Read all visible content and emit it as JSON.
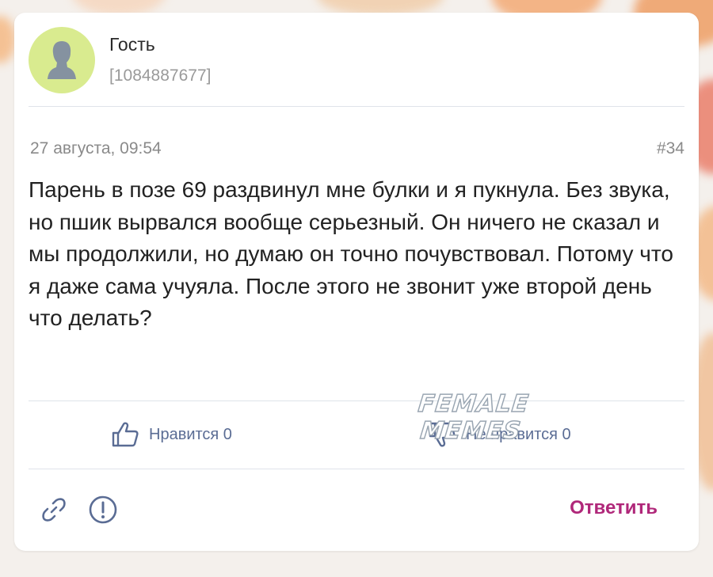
{
  "author": {
    "name": "Гость",
    "id": "[1084887677]"
  },
  "post": {
    "date": "27 августа, 09:54",
    "number": "#34",
    "text": "Парень в позе 69 раздвинул мне булки и я пукнула. Без звука, но пшик вырвался вообще серьезный. Он ничего не сказал и мы продолжили, но думаю он точно почувствовал. Потому что я даже сама учуяла. После этого не звонит уже второй день что делать?"
  },
  "reactions": {
    "like_label": "Нравится 0",
    "dislike_label": "Не нравится 0"
  },
  "watermark": {
    "line1": "FEMALE",
    "line2": "MEMES"
  },
  "actions": {
    "reply_label": "Ответить"
  },
  "icons": {
    "avatar": "user-silhouette-icon",
    "like": "thumbs-up-icon",
    "dislike": "thumbs-down-icon",
    "link": "link-icon",
    "report": "exclamation-circle-icon"
  },
  "colors": {
    "accent": "#b0287a",
    "reaction": "#5a6c94",
    "avatar_bg": "#d9eb8f"
  }
}
